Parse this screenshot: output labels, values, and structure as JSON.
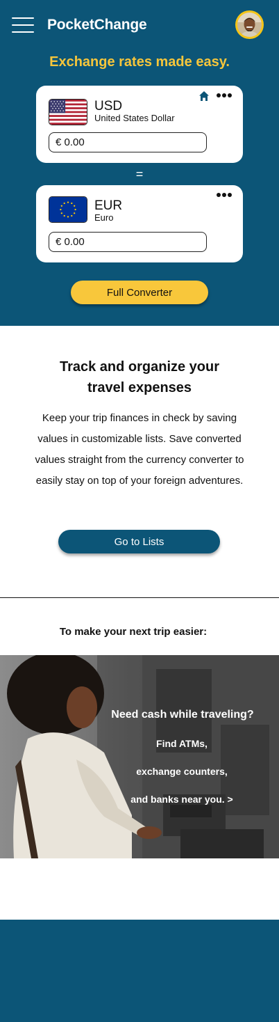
{
  "header": {
    "app_title": "PocketChange",
    "menu_icon": "hamburger-menu-icon",
    "avatar": "user-avatar"
  },
  "hero": {
    "tagline": "Exchange rates made easy.",
    "from": {
      "code": "USD",
      "name": "United States Dollar",
      "amount": "€ 0.00",
      "flag": "us-flag-icon"
    },
    "equals": "=",
    "to": {
      "code": "EUR",
      "name": "Euro",
      "amount": "€ 0.00",
      "flag": "eu-flag-icon"
    },
    "full_converter_label": "Full Converter"
  },
  "lists": {
    "title_line1": "Track and organize your",
    "title_line2": "travel expenses",
    "body": "Keep your trip finances in check by saving values in customizable lists. Save converted values straight from the currency converter to easily stay on top of your foreign adventures.",
    "button_label": "Go to Lists"
  },
  "trip": {
    "heading": "To make your next trip easier:",
    "promo_line1": "Need cash while traveling?",
    "promo_line2": "Find ATMs,",
    "promo_line3": "exchange counters,",
    "promo_line4": "and banks near you. >"
  },
  "colors": {
    "brand_blue": "#0c5577",
    "accent_yellow": "#f8c73b",
    "tagline_yellow": "#f7c63b"
  }
}
